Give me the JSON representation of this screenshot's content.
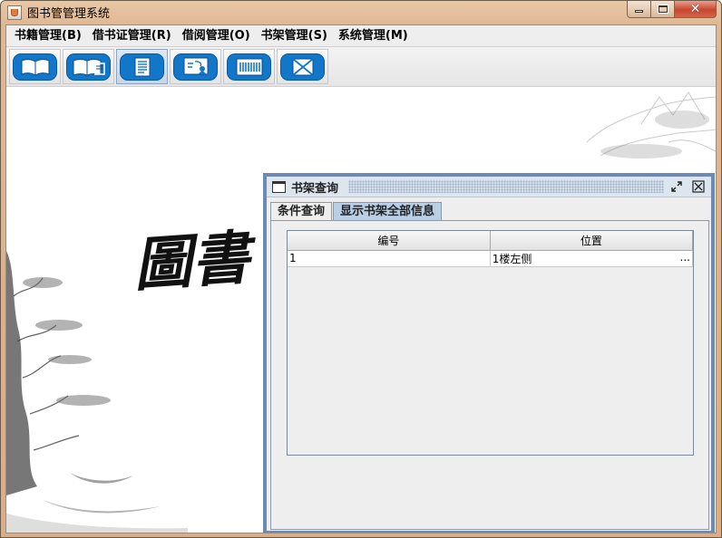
{
  "window": {
    "title": "图书管管理系统",
    "controls": {
      "minimize": "minimize",
      "maximize": "maximize",
      "close": "close"
    }
  },
  "menubar": {
    "items": [
      {
        "label": "书籍管理(B)"
      },
      {
        "label": "借书证管理(R)"
      },
      {
        "label": "借阅管理(O)"
      },
      {
        "label": "书架管理(S)"
      },
      {
        "label": "系统管理(M)"
      }
    ]
  },
  "toolbar": {
    "buttons": [
      {
        "icon": "open-book-icon"
      },
      {
        "icon": "books-icon"
      },
      {
        "icon": "document-list-icon"
      },
      {
        "icon": "presentation-board-icon"
      },
      {
        "icon": "barcode-icon"
      },
      {
        "icon": "envelope-icon"
      }
    ]
  },
  "background": {
    "calligraphy": "圖書"
  },
  "internal_frame": {
    "title": "书架查询",
    "tabs": [
      {
        "label": "条件查询",
        "selected": false
      },
      {
        "label": "显示书架全部信息",
        "selected": true
      }
    ],
    "table": {
      "columns": [
        "编号",
        "位置"
      ],
      "rows": [
        {
          "id": "1",
          "location": "1楼左侧",
          "overflow": "..."
        }
      ]
    }
  },
  "colors": {
    "title_gradient": "#dfb894",
    "toolbar_icon": "#1276c9",
    "frame_border": "#6d8ab5",
    "selected_tab": "#b8cfe5"
  }
}
